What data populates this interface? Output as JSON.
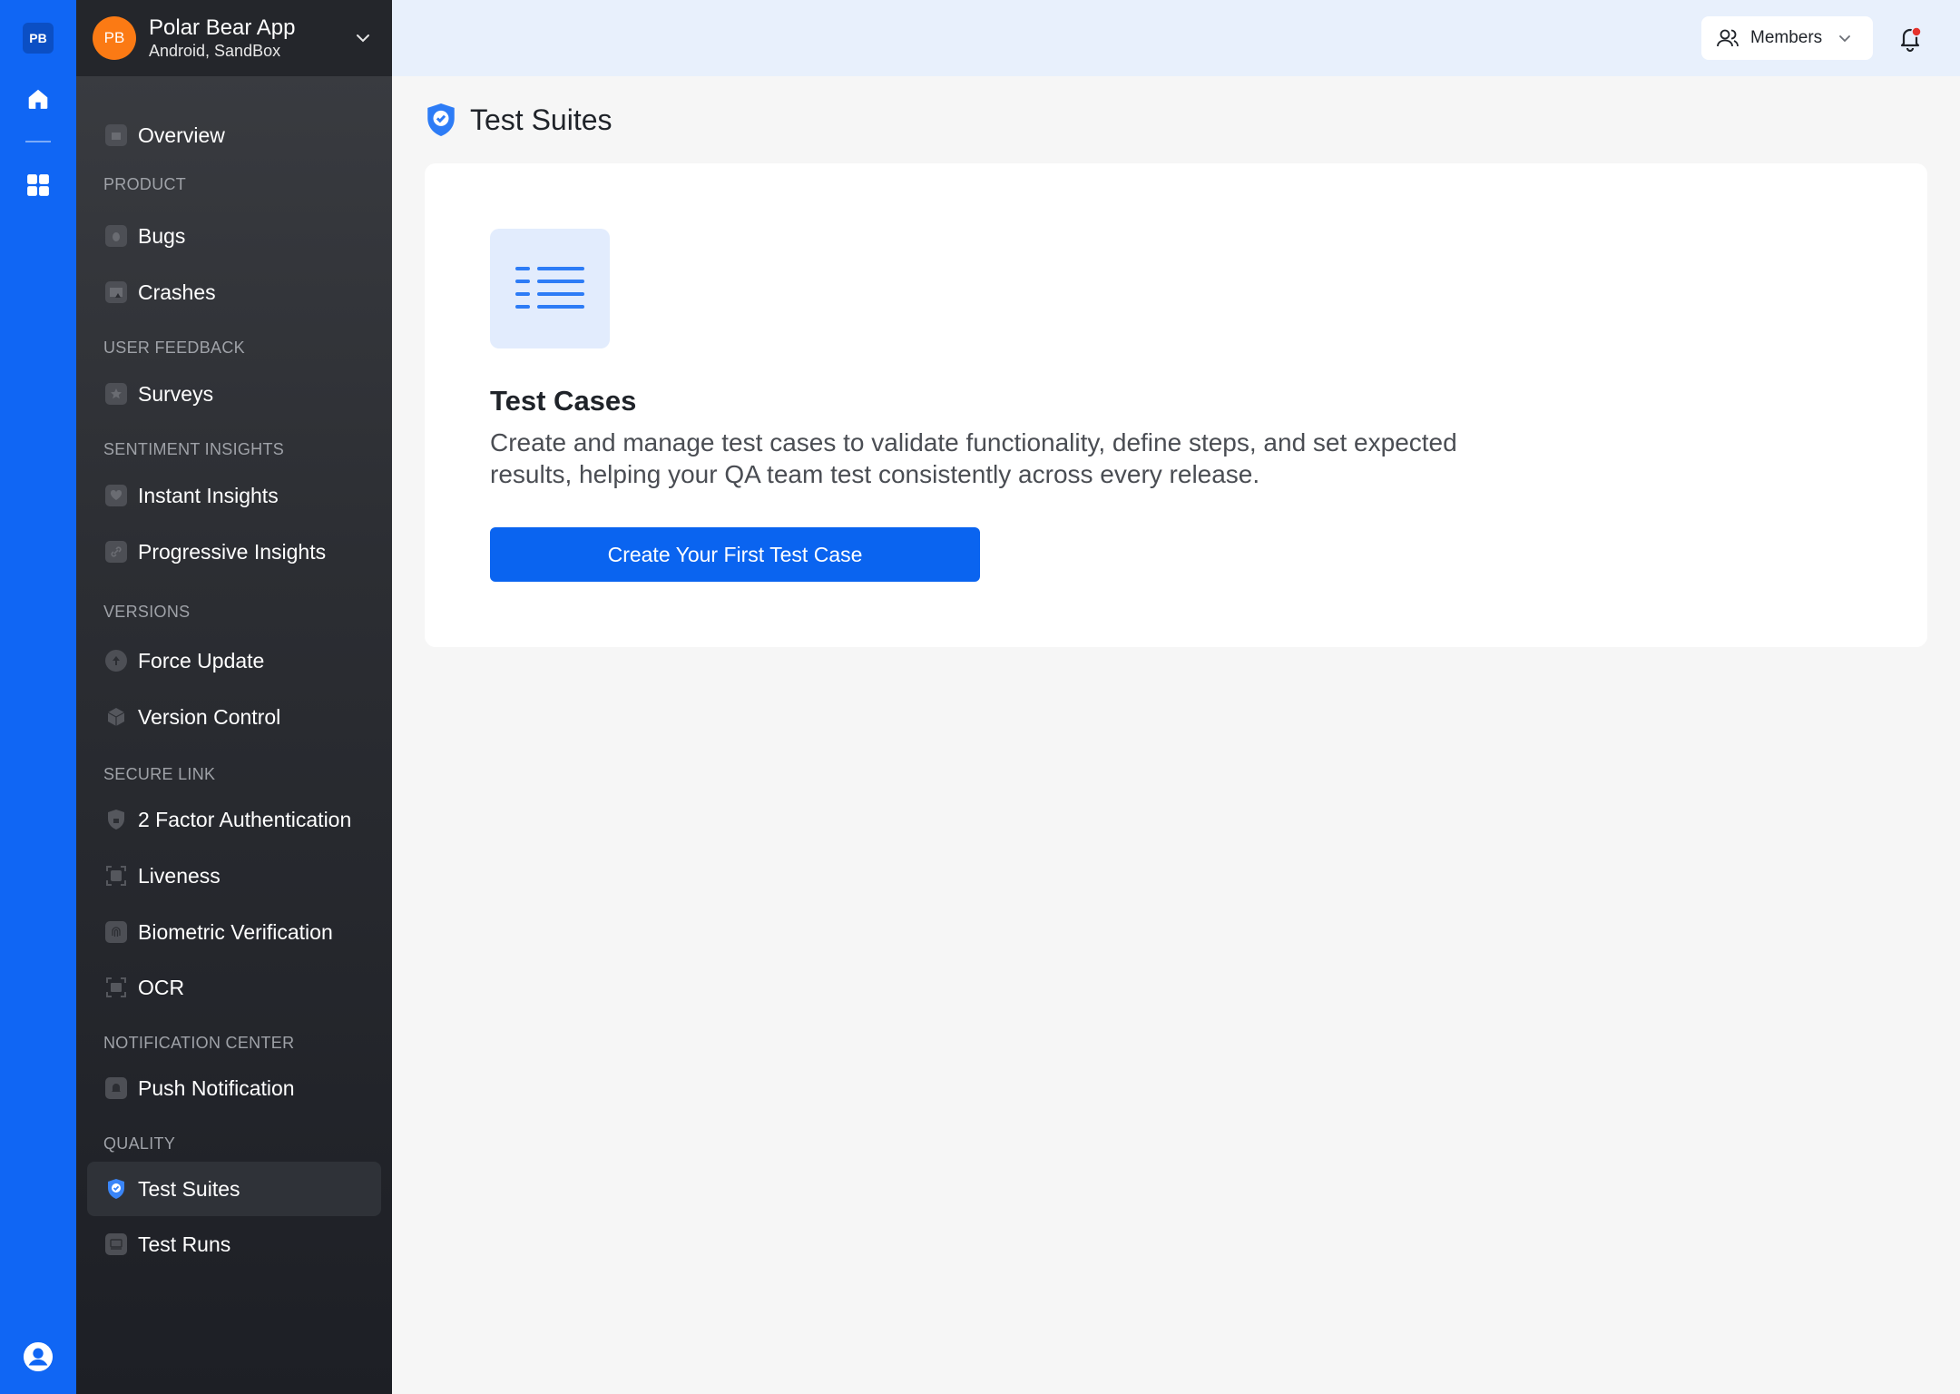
{
  "rail": {
    "org_initials": "PB"
  },
  "app": {
    "initials": "PB",
    "name": "Polar Bear App",
    "subtitle": "Android, SandBox"
  },
  "sidebar": {
    "overview": "Overview",
    "sections": {
      "product": "PRODUCT",
      "user_feedback": "USER FEEDBACK",
      "sentiment": "SENTIMENT INSIGHTS",
      "versions": "VERSIONS",
      "secure_link": "SECURE LINK",
      "notification": "NOTIFICATION CENTER",
      "quality": "QUALITY"
    },
    "items": {
      "bugs": "Bugs",
      "crashes": "Crashes",
      "surveys": "Surveys",
      "instant_insights": "Instant Insights",
      "progressive_insights": "Progressive Insights",
      "force_update": "Force Update",
      "version_control": "Version Control",
      "two_factor": "2 Factor Authentication",
      "liveness": "Liveness",
      "biometric": "Biometric Verification",
      "ocr": "OCR",
      "push_notification": "Push Notification",
      "test_suites": "Test Suites",
      "test_runs": "Test Runs"
    },
    "active_item": "Test Suites"
  },
  "topbar": {
    "members_label": "Members",
    "notification_dot_color": "#e5312b"
  },
  "main": {
    "page_title": "Test Suites",
    "card": {
      "title": "Test Cases",
      "description": "Create and manage test cases to validate functionality, define steps, and set expected results, helping your QA team test consistently across every release.",
      "cta_label": "Create Your First Test Case"
    }
  },
  "colors": {
    "rail": "#1066f4",
    "primary": "#0a64f0",
    "accent_orange": "#fb7a14"
  }
}
